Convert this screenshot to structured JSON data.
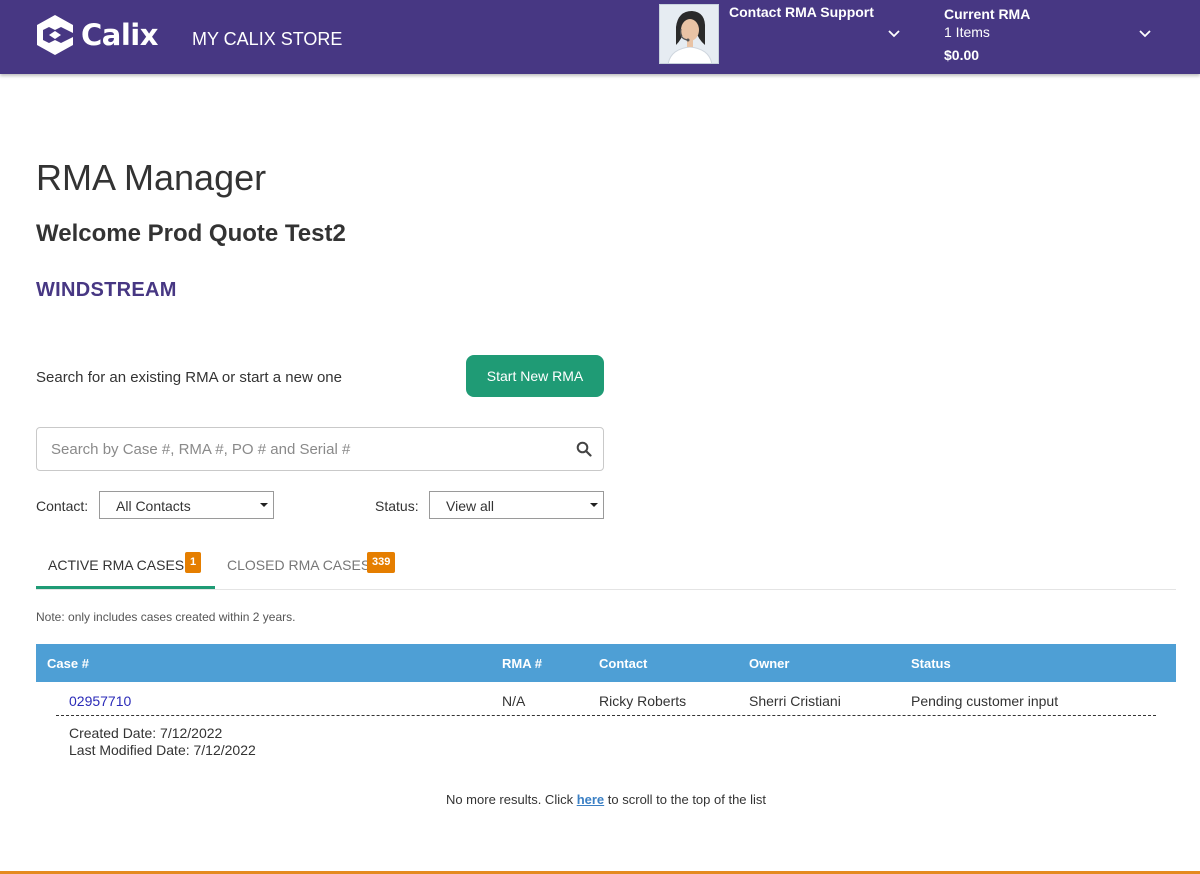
{
  "header": {
    "brand": "Calix",
    "store_title": "MY CALIX STORE",
    "support_label": "Contact RMA Support",
    "current_rma_title": "Current RMA",
    "current_rma_items": "1 Items",
    "current_rma_total": "$0.00",
    "background_color": "#473783"
  },
  "page": {
    "title": "RMA Manager",
    "welcome": "Welcome Prod Quote Test2",
    "company": "WINDSTREAM",
    "search_prompt": "Search for an existing RMA or start a new one",
    "start_button": "Start New RMA",
    "accent_color": "#1f9b75"
  },
  "search": {
    "placeholder": "Search by Case #, RMA #, PO # and Serial #",
    "value": ""
  },
  "filters": {
    "contact_label": "Contact:",
    "contact_value": "All Contacts",
    "status_label": "Status:",
    "status_value": "View all"
  },
  "tabs": [
    {
      "label": "ACTIVE RMA CASES",
      "count": "1",
      "active": true
    },
    {
      "label": "CLOSED RMA CASES",
      "count": "339",
      "active": false
    }
  ],
  "note": "Note: only includes cases created within 2 years.",
  "table": {
    "headers": [
      "Case #",
      "RMA #",
      "Contact",
      "Owner",
      "Status"
    ],
    "rows": [
      {
        "case": "02957710",
        "rma": "N/A",
        "contact": "Ricky Roberts",
        "owner": "Sherri Cristiani",
        "status": "Pending customer input",
        "created": "Created Date: 7/12/2022",
        "modified": "Last Modified Date: 7/12/2022"
      }
    ],
    "header_color": "#4e9fd5"
  },
  "footer": {
    "prefix": "No more results. Click ",
    "link": "here",
    "suffix": " to scroll to the top of the list"
  }
}
